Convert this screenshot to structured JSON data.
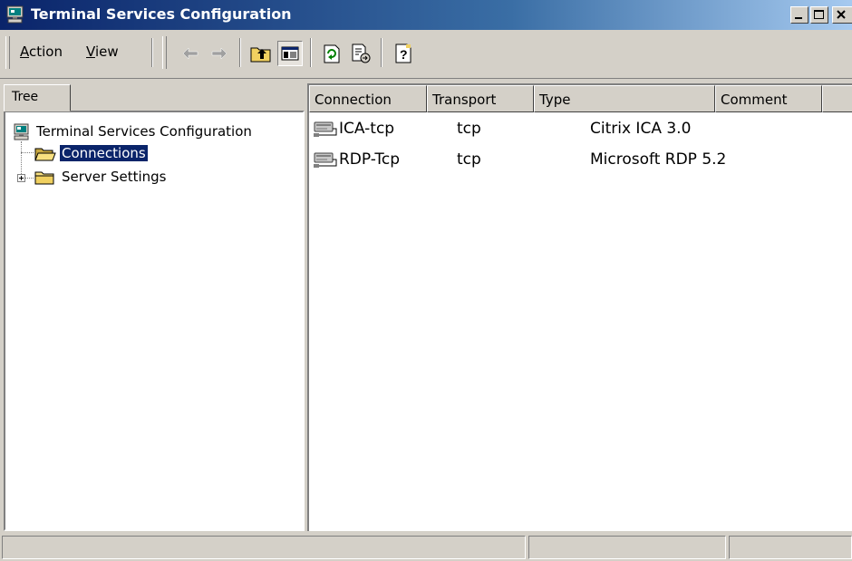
{
  "window": {
    "title": "Terminal Services Configuration",
    "icon": "terminal-services-icon"
  },
  "caption_buttons": [
    "minimize-icon",
    "maximize-icon",
    "close-icon"
  ],
  "menu": {
    "action": {
      "label": "Action",
      "accel": "A",
      "rest": "ction"
    },
    "view": {
      "label": "View",
      "accel": "V",
      "rest": "iew"
    }
  },
  "toolbar": {
    "buttons": [
      {
        "name": "back-arrow-icon",
        "enabled": false
      },
      {
        "name": "forward-arrow-icon",
        "enabled": false
      },
      {
        "name": "up-one-level-icon",
        "enabled": true
      },
      {
        "name": "show-hide-console-tree-icon",
        "enabled": true,
        "pressed": true
      },
      {
        "name": "refresh-icon",
        "enabled": true
      },
      {
        "name": "export-list-icon",
        "enabled": true
      },
      {
        "name": "help-icon",
        "enabled": true
      }
    ]
  },
  "tree": {
    "tab_label": "Tree",
    "root": {
      "label": "Terminal Services Configuration",
      "icon": "terminal-services-icon"
    },
    "items": [
      {
        "label": "Connections",
        "icon": "open-folder-icon",
        "selected": true
      },
      {
        "label": "Server Settings",
        "icon": "folder-icon",
        "expander": "+"
      }
    ]
  },
  "list": {
    "columns": [
      "Connection",
      "Transport",
      "Type",
      "Comment"
    ],
    "rows": [
      {
        "connection": "ICA-tcp",
        "transport": "tcp",
        "type": "Citrix ICA 3.0",
        "comment": "",
        "icon": "connection-icon"
      },
      {
        "connection": "RDP-Tcp",
        "transport": "tcp",
        "type": "Microsoft RDP 5.2",
        "comment": "",
        "icon": "connection-icon"
      }
    ]
  },
  "colors": {
    "titlebar_start": "#0a246a",
    "titlebar_end": "#a6caf0",
    "face": "#d4d0c8",
    "selection": "#0a246a"
  }
}
